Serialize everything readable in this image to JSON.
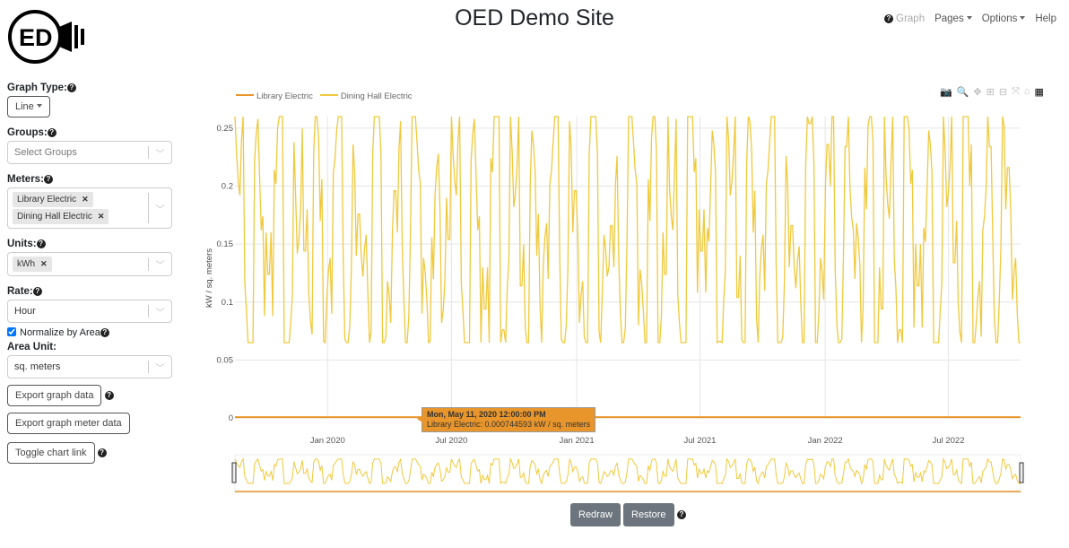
{
  "header": {
    "title": "OED Demo Site",
    "logo_text": "ED",
    "nav": {
      "graph": "Graph",
      "pages": "Pages",
      "options": "Options",
      "help": "Help"
    }
  },
  "sidebar": {
    "graph_type_label": "Graph Type:",
    "graph_type": "Line",
    "groups_label": "Groups:",
    "groups_placeholder": "Select Groups",
    "meters_label": "Meters:",
    "meters": [
      "Library Electric",
      "Dining Hall Electric"
    ],
    "units_label": "Units:",
    "units": [
      "kWh"
    ],
    "rate_label": "Rate:",
    "rate": "Hour",
    "normalize_label": "Normalize by Area",
    "normalize_checked": true,
    "area_unit_label": "Area Unit:",
    "area_unit": "sq. meters",
    "export_graph": "Export graph data",
    "export_meter": "Export graph meter data",
    "toggle_link": "Toggle chart link"
  },
  "chart_data": {
    "type": "line",
    "ylabel": "kW / sq. meters",
    "ylim": [
      0,
      0.26
    ],
    "yticks": [
      "0",
      "0.05",
      "0.1",
      "0.15",
      "0.2",
      "0.25"
    ],
    "xlim": [
      "2019-08-18",
      "2022-10-15"
    ],
    "xticks": [
      "Jan 2020",
      "Jul 2020",
      "Jan 2021",
      "Jul 2021",
      "Jan 2022",
      "Jul 2022"
    ],
    "grid": true,
    "legend": "top-left",
    "series": [
      {
        "name": "Library Electric",
        "color": "#e8962c",
        "values": [
          0.0007,
          0.0008,
          0.0007,
          0.0007
        ]
      },
      {
        "name": "Dining Hall Electric",
        "color": "#f0c93c",
        "values": [
          0.24,
          0.08,
          0.21,
          0.1,
          0.25,
          0.07,
          0.19,
          0.12,
          0.23,
          0.09,
          0.26,
          0.08,
          0.2,
          0.11,
          0.24,
          0.07,
          0.22,
          0.1,
          0.25,
          0.09,
          0.18,
          0.13,
          0.24,
          0.08,
          0.21,
          0.07,
          0.26,
          0.1,
          0.23,
          0.09,
          0.2,
          0.12,
          0.25,
          0.08,
          0.22,
          0.07,
          0.24,
          0.11,
          0.19,
          0.09,
          0.25,
          0.08,
          0.23,
          0.1,
          0.21,
          0.07,
          0.26,
          0.12,
          0.2,
          0.09,
          0.24,
          0.08,
          0.22,
          0.11,
          0.25,
          0.07,
          0.19,
          0.1,
          0.23,
          0.09,
          0.26,
          0.08,
          0.21,
          0.12,
          0.24,
          0.07,
          0.22,
          0.1,
          0.25,
          0.09,
          0.2,
          0.08,
          0.23,
          0.11,
          0.26,
          0.07,
          0.21,
          0.1,
          0.24,
          0.09
        ]
      }
    ],
    "tooltip": {
      "date": "Mon, May 11, 2020 12:00:00 PM",
      "text": "Library Electric: 0.000744593 kW / sq. meters"
    }
  },
  "buttons": {
    "redraw": "Redraw",
    "restore": "Restore"
  }
}
